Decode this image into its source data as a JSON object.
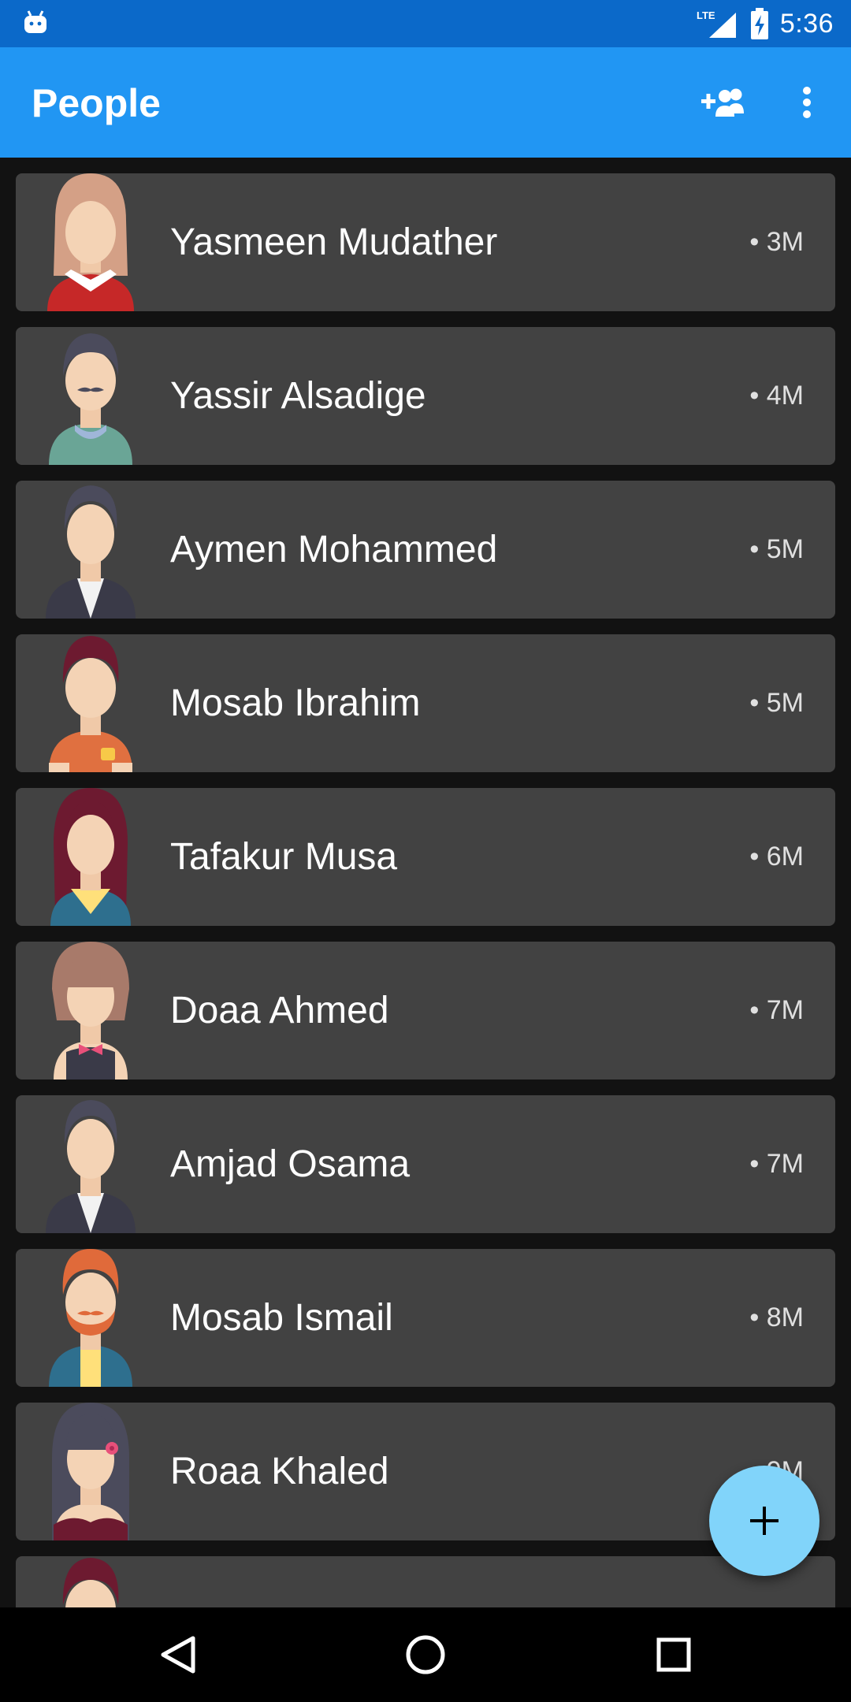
{
  "status_bar": {
    "network": "LTE",
    "time": "5:36",
    "icons": [
      "android-icon",
      "lte-signal-icon",
      "battery-charging-icon"
    ]
  },
  "app_bar": {
    "title": "People",
    "actions": [
      "add-people-icon",
      "overflow-menu-icon"
    ]
  },
  "people": [
    {
      "name": "Yasmeen Mudather",
      "age": "• 3M",
      "avatar": "woman-red-top"
    },
    {
      "name": "Yassir Alsadige",
      "age": "• 4M",
      "avatar": "man-mustache"
    },
    {
      "name": "Aymen Mohammed",
      "age": "• 5M",
      "avatar": "man-suit"
    },
    {
      "name": "Mosab Ibrahim",
      "age": "• 5M",
      "avatar": "man-orange-shirt"
    },
    {
      "name": "Tafakur Musa",
      "age": "• 6M",
      "avatar": "woman-long-hair"
    },
    {
      "name": "Doaa Ahmed",
      "age": "• 7M",
      "avatar": "woman-bow"
    },
    {
      "name": "Amjad Osama",
      "age": "• 7M",
      "avatar": "man-suit"
    },
    {
      "name": "Mosab Ismail",
      "age": "• 8M",
      "avatar": "man-beard"
    },
    {
      "name": "Roaa Khaled",
      "age": "• 9M",
      "avatar": "woman-flower"
    },
    {
      "name": "",
      "age": "",
      "avatar": "man-dark-hair"
    }
  ],
  "fab": {
    "icon": "plus-icon"
  },
  "nav_bar": {
    "buttons": [
      "back-icon",
      "home-icon",
      "recents-icon"
    ]
  },
  "colors": {
    "status_bar": "#0b69c9",
    "app_bar": "#2196f3",
    "background": "#121212",
    "card": "#424242",
    "fab": "#81d4fa"
  }
}
